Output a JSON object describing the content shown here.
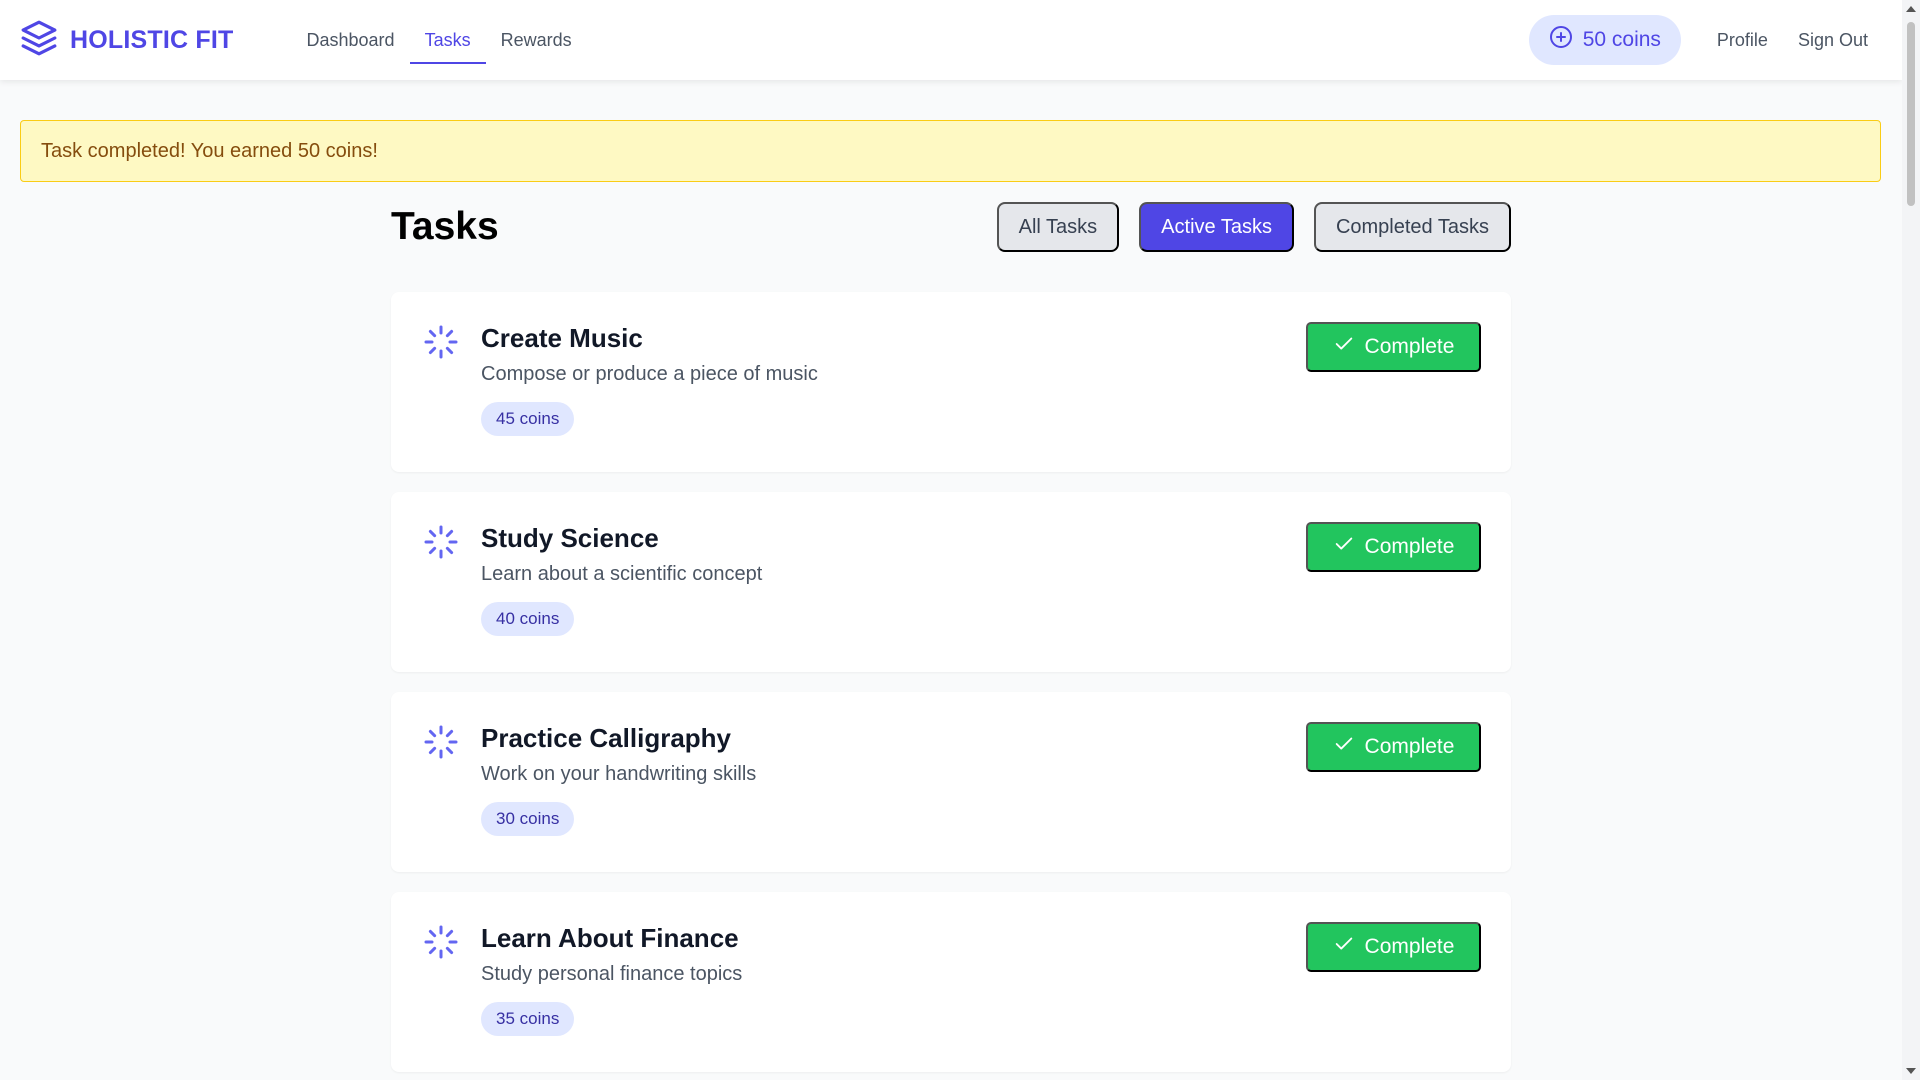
{
  "brand": {
    "name": "HOLISTIC FIT",
    "icon": "layers-icon",
    "color": "#4f46e5"
  },
  "nav": {
    "links": [
      {
        "label": "Dashboard",
        "active": false
      },
      {
        "label": "Tasks",
        "active": true
      },
      {
        "label": "Rewards",
        "active": false
      }
    ],
    "coins_label": "50 coins",
    "profile_label": "Profile",
    "signout_label": "Sign Out"
  },
  "alert": {
    "message": "Task completed! You earned 50 coins!"
  },
  "page": {
    "title": "Tasks",
    "filters": [
      {
        "label": "All Tasks",
        "active": false
      },
      {
        "label": "Active Tasks",
        "active": true
      },
      {
        "label": "Completed Tasks",
        "active": false
      }
    ]
  },
  "tasks": [
    {
      "title": "Create Music",
      "description": "Compose or produce a piece of music",
      "reward": "45 coins",
      "action_label": "Complete",
      "status_icon": "loader-icon"
    },
    {
      "title": "Study Science",
      "description": "Learn about a scientific concept",
      "reward": "40 coins",
      "action_label": "Complete",
      "status_icon": "loader-icon"
    },
    {
      "title": "Practice Calligraphy",
      "description": "Work on your handwriting skills",
      "reward": "30 coins",
      "action_label": "Complete",
      "status_icon": "loader-icon"
    },
    {
      "title": "Learn About Finance",
      "description": "Study personal finance topics",
      "reward": "35 coins",
      "action_label": "Complete",
      "status_icon": "loader-icon"
    }
  ],
  "colors": {
    "accent": "#4f46e5",
    "success": "#22c55e",
    "alert_bg": "#fef9c3",
    "alert_text": "#854d0e"
  }
}
